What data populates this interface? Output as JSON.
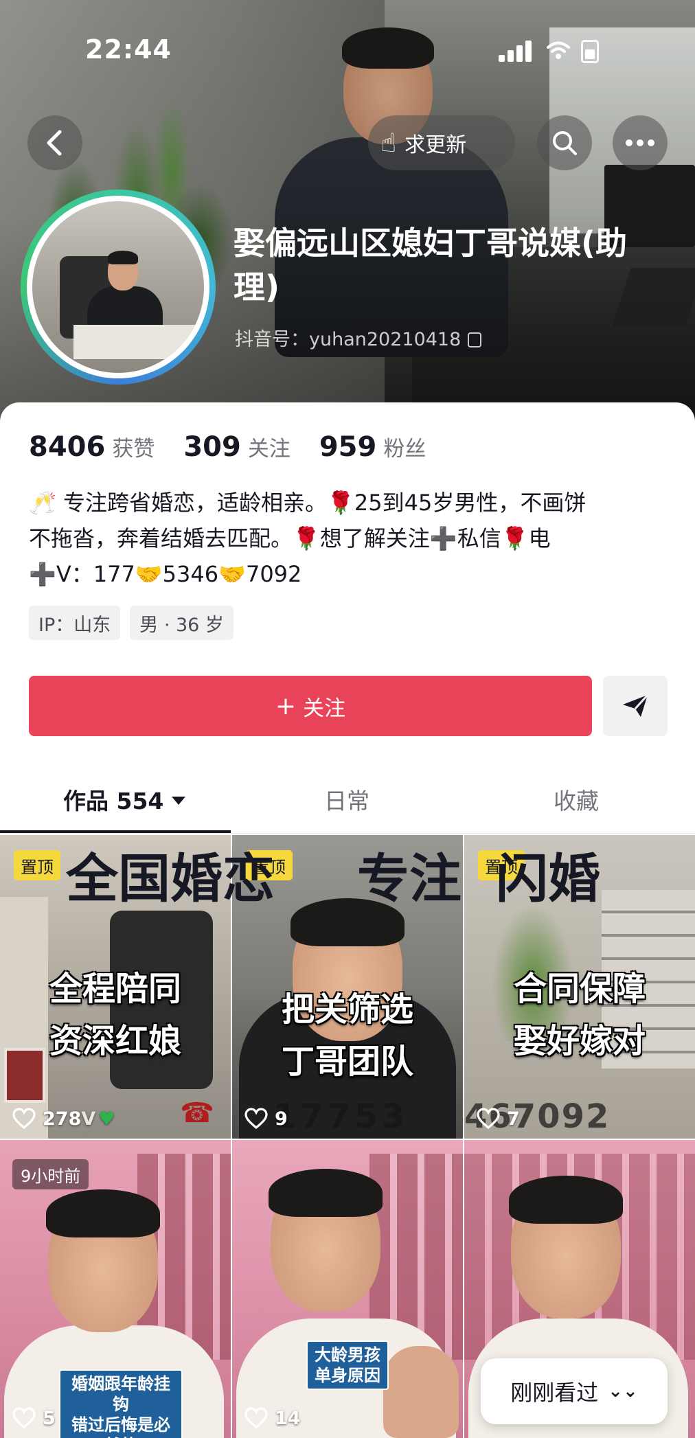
{
  "status_bar": {
    "time": "22:44"
  },
  "header": {
    "update_request_label": "求更新",
    "profile_name": "娶偏远山区媳妇丁哥说媒(助理)",
    "douyin_id_label": "抖音号：",
    "douyin_id": "yuhan20210418"
  },
  "stats": [
    {
      "value": "8406",
      "label": "获赞"
    },
    {
      "value": "309",
      "label": "关注"
    },
    {
      "value": "959",
      "label": "粉丝"
    }
  ],
  "bio": {
    "line1_a": "专注跨省婚恋，适龄相亲。",
    "line1_b": "25到45岁男性，不画饼",
    "line2_a": "不拖沓，奔着结婚去匹配。",
    "line2_b": "想了解关注",
    "line2_c": "私信",
    "line2_d": "电",
    "line3_a": "V：177",
    "line3_b": "5346",
    "line3_c": "7092",
    "emoji_cheers": "🥂",
    "emoji_rose": "🌹",
    "emoji_plus": "➕",
    "emoji_handshake": "🤝"
  },
  "tags": [
    "IP：山东",
    "男 · 36 岁"
  ],
  "actions": {
    "follow_label": "关注",
    "follow_plus": "+"
  },
  "tabs": {
    "works_label": "作品 554",
    "daily_label": "日常",
    "favorites_label": "收藏"
  },
  "videos": [
    {
      "pinned": "置顶",
      "overlay_top": "全程陪同",
      "overlay_bottom": "资深红娘",
      "likes": "278",
      "extra": "V"
    },
    {
      "pinned": "置顶",
      "overlay_top": "把关筛选",
      "overlay_bottom": "丁哥团队",
      "likes": "9",
      "ghost": "17753"
    },
    {
      "pinned": "置顶",
      "overlay_top": "合同保障",
      "overlay_bottom": "娶好嫁对",
      "likes": "7",
      "ghost": "467092"
    },
    {
      "time_badge": "9小时前",
      "caption": "婚姻跟年龄挂钩\n错过后悔是必然的",
      "likes": "5"
    },
    {
      "caption": "大龄男孩\n单身原因",
      "likes": "14"
    },
    {
      "caption": ""
    }
  ],
  "banner": {
    "part1": "全国婚恋",
    "part2": "专注",
    "part3": "闪婚"
  },
  "just_viewed": {
    "label": "刚刚看过"
  },
  "colors": {
    "follow": "#e94359",
    "pin": "#f5d83c",
    "ring": "#3cc7a0"
  }
}
